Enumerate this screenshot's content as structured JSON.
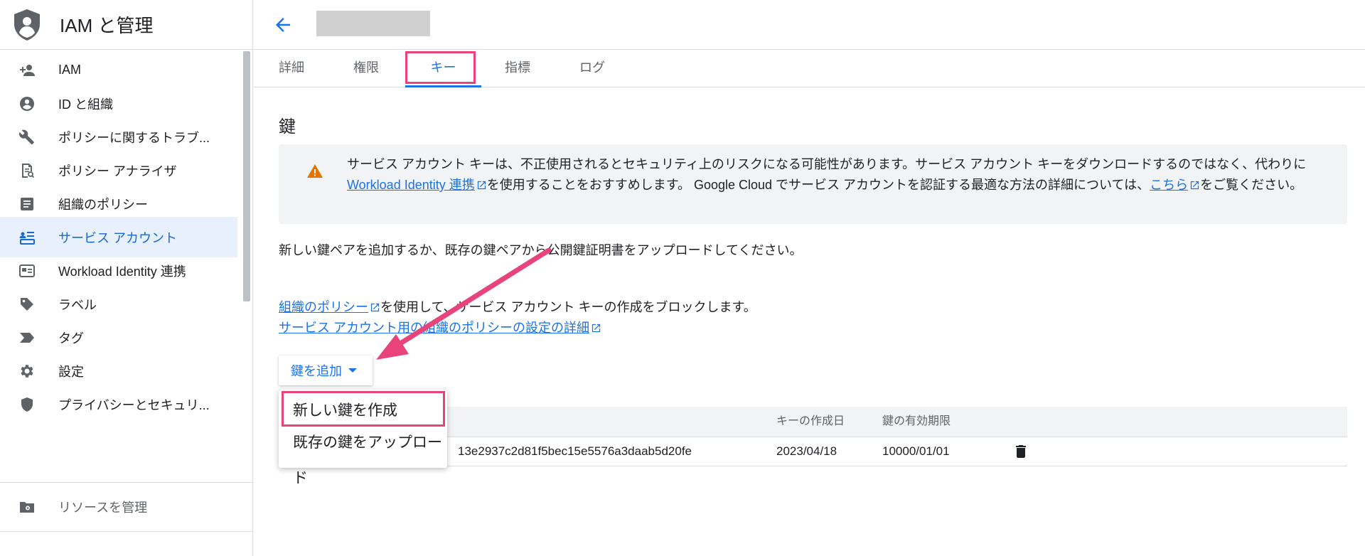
{
  "app": {
    "title": "IAM と管理"
  },
  "sidebar": {
    "items": [
      {
        "label": "IAM",
        "icon": "person-add-icon"
      },
      {
        "label": "ID と組織",
        "icon": "account-circle-icon"
      },
      {
        "label": "ポリシーに関するトラブ...",
        "icon": "wrench-icon"
      },
      {
        "label": "ポリシー アナライザ",
        "icon": "document-search-icon"
      },
      {
        "label": "組織のポリシー",
        "icon": "list-document-icon"
      },
      {
        "label": "サービス アカウント",
        "icon": "service-account-icon",
        "active": true
      },
      {
        "label": "Workload Identity 連携",
        "icon": "id-card-icon"
      },
      {
        "label": "ラベル",
        "icon": "label-tag-icon"
      },
      {
        "label": "タグ",
        "icon": "tag-chevron-icon"
      },
      {
        "label": "設定",
        "icon": "gear-icon"
      },
      {
        "label": "プライバシーとセキュリ...",
        "icon": "shield-icon"
      }
    ],
    "footer_label": "リソースを管理"
  },
  "tabs": [
    "詳細",
    "権限",
    "キー",
    "指標",
    "ログ"
  ],
  "active_tab": "キー",
  "section_title": "鍵",
  "warning": {
    "text_1": "サービス アカウント キーは、不正使用されるとセキュリティ上のリスクになる可能性があります。サービス アカウント キーをダウンロードするのではなく、代わりに ",
    "link_1": "Workload Identity 連携",
    "text_2": "を使用することをおすすめします。 Google Cloud でサービス アカウントを認証する最適な方法の詳細については、",
    "link_2": "こちら",
    "text_3": "をご覧ください。"
  },
  "description": "新しい鍵ペアを追加するか、既存の鍵ペアから公開鍵証明書をアップロードしてください。",
  "policy": {
    "link_1": "組織のポリシー",
    "text_1": "を使用して、サービス アカウント キーの作成をブロックします。",
    "link_2": "サービス アカウント用の組織のポリシーの設定の詳細"
  },
  "add_key_button": "鍵を追加",
  "dropdown": {
    "items": [
      "新しい鍵を作成",
      "既存の鍵をアップロード"
    ]
  },
  "table": {
    "headers": {
      "created": "キーの作成日",
      "expires": "鍵の有効期限"
    },
    "rows": [
      {
        "key_id": "13e2937c2d81f5bec15e5576a3daab5d20fe",
        "created": "2023/04/18",
        "expires": "10000/01/01"
      }
    ]
  },
  "colors": {
    "accent": "#1a73e8",
    "highlight": "#e8437a",
    "warning": "#e37400"
  }
}
